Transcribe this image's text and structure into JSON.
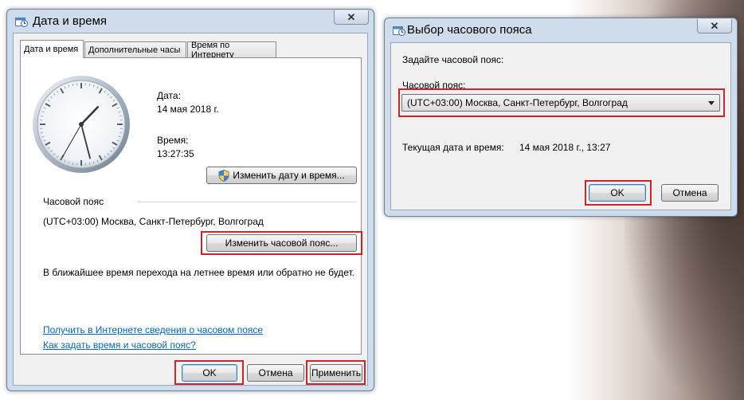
{
  "main_dialog": {
    "title": "Дата и время",
    "close_label": "✕",
    "tabs": [
      {
        "label": "Дата и время",
        "active": true
      },
      {
        "label": "Дополнительные часы",
        "active": false
      },
      {
        "label": "Время по Интернету",
        "active": false
      }
    ],
    "clock": {
      "hour": 13,
      "minute": 27,
      "second": 35
    },
    "date_label": "Дата:",
    "date_value": "14 мая 2018 г.",
    "time_label": "Время:",
    "time_value": "13:27:35",
    "change_datetime_button": "Изменить дату и время...",
    "timezone_section_label": "Часовой пояс",
    "timezone_value": "(UTC+03:00) Москва, Санкт-Петербург, Волгоград",
    "change_timezone_button": "Изменить часовой пояс...",
    "dst_notice": "В ближайшее время перехода на летнее время или обратно не будет.",
    "link_online_info": "Получить в Интернете сведения о часовом поясе",
    "link_how_to": "Как задать время и часовой пояс?",
    "ok_button": "OK",
    "cancel_button": "Отмена",
    "apply_button": "Применить"
  },
  "tz_dialog": {
    "title": "Выбор часового пояса",
    "close_label": "✕",
    "instruction": "Задайте часовой пояс:",
    "timezone_label": "Часовой пояс:",
    "timezone_selected": "(UTC+03:00) Москва, Санкт-Петербург, Волгоград",
    "current_label": "Текущая дата и время:",
    "current_value": "14 мая 2018 г., 13:27",
    "ok_button": "OK",
    "cancel_button": "Отмена"
  },
  "colors": {
    "highlight": "#d2232a",
    "link": "#0066cc",
    "window_frame": "#cfdceb"
  },
  "icons": {
    "main_title": "calendar-clock-icon",
    "tz_title": "calendar-clock-icon",
    "uac_shield": "uac-shield-icon"
  }
}
